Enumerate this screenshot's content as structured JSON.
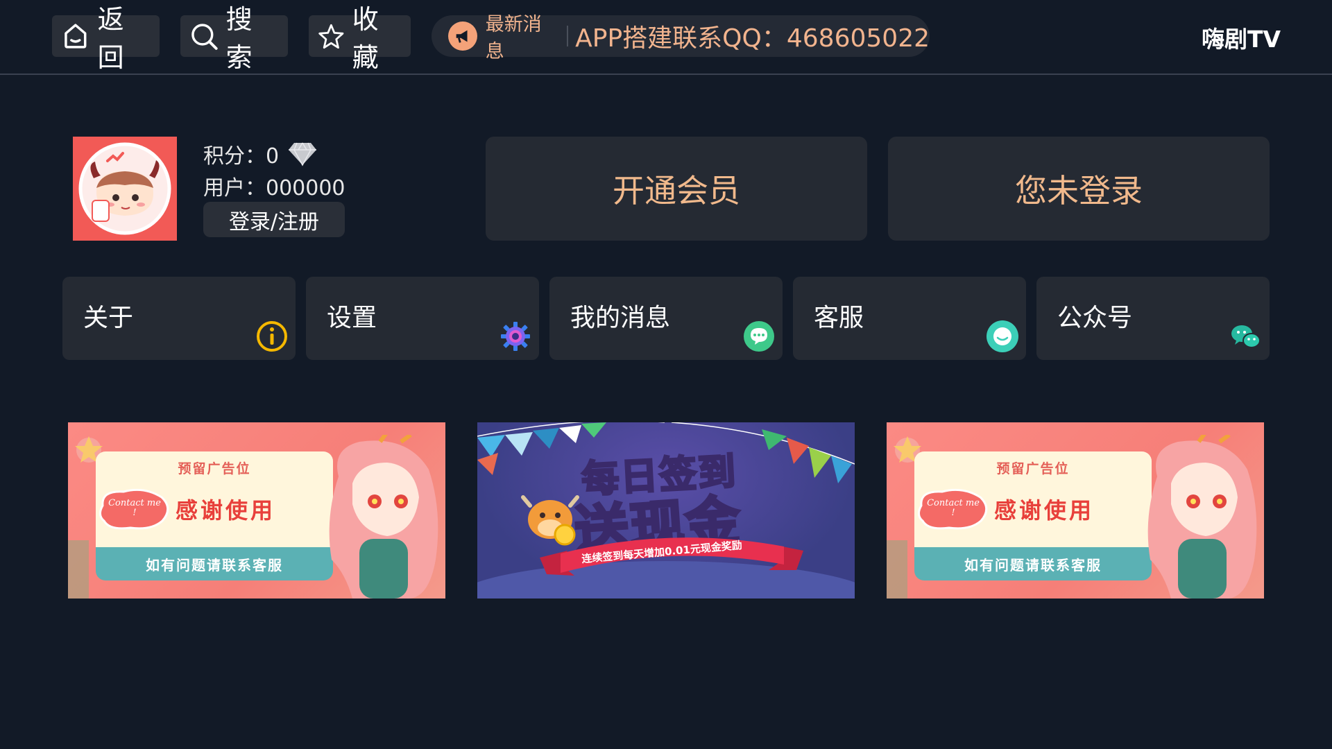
{
  "topbar": {
    "back_label": "返回",
    "search_label": "搜索",
    "favorites_label": "收藏",
    "news_tag": "最新消息",
    "news_text": "APP搭建联系QQ：468605022",
    "brand": "嗨剧TV"
  },
  "user": {
    "points_label": "积分：0",
    "user_label": "用户：000000",
    "login_button": "登录/注册"
  },
  "actions": {
    "vip": "开通会员",
    "login_status": "您未登录"
  },
  "menu": [
    {
      "label": "关于",
      "icon": "info-icon",
      "color": "#f5b800"
    },
    {
      "label": "设置",
      "icon": "gear-icon",
      "color": "#7a63f0"
    },
    {
      "label": "我的消息",
      "icon": "chat-bubble-icon",
      "color": "#3ec98a"
    },
    {
      "label": "客服",
      "icon": "customer-service-icon",
      "color": "#3ccfb8"
    },
    {
      "label": "公众号",
      "icon": "wechat-icon",
      "color": "#27b9a0"
    }
  ],
  "banners": {
    "ad_left": {
      "subtitle": "预留广告位",
      "title": "感谢使用",
      "footer": "如有问题请联系客服",
      "bubble": "Contact me !"
    },
    "promo": {
      "title_top": "每日签到",
      "title_main": "送现金",
      "ribbon": "连续签到每天增加0.01元现金奖励"
    },
    "ad_right": {
      "subtitle": "预留广告位",
      "title": "感谢使用",
      "footer": "如有问题请联系客服",
      "bubble": "Contact me !"
    }
  },
  "colors": {
    "background": "#121a27",
    "accent_text": "#f1b98c",
    "tile_bg": "#252a33"
  }
}
